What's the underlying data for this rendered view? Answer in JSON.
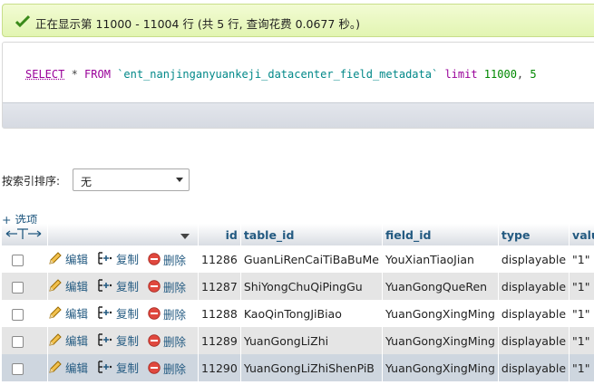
{
  "banner": {
    "message": "正在显示第 11000 - 11004 行 (共 5 行, 查询花费 0.0677 秒。)"
  },
  "sql": {
    "select_kw": "SELECT",
    "star": " * ",
    "from_kw": "FROM",
    "table_name": "`ent_nanjinganyuankeji_datacenter_field_metadata`",
    "limit_kw": "limit",
    "offset": "11000",
    "comma": ", ",
    "count": "5"
  },
  "sort": {
    "label": "按索引排序:",
    "selected": "无"
  },
  "options_link": "+ 选项",
  "table": {
    "headers": [
      "id",
      "table_id",
      "field_id",
      "type",
      "value"
    ],
    "actions": {
      "edit": "编辑",
      "copy": "复制",
      "delete": "删除"
    },
    "rows": [
      {
        "id": "11286",
        "table_id": "GuanLiRenCaiTiBaBuMe",
        "field_id": "YouXianTiaoJian",
        "type": "displayable",
        "value": "\"1\""
      },
      {
        "id": "11287",
        "table_id": "ShiYongChuQiPingGu",
        "field_id": "YuanGongQueRen",
        "type": "displayable",
        "value": "\"1\""
      },
      {
        "id": "11288",
        "table_id": "KaoQinTongJiBiao",
        "field_id": "YuanGongXingMing",
        "type": "displayable",
        "value": "\"1\""
      },
      {
        "id": "11289",
        "table_id": "YuanGongLiZhi",
        "field_id": "YuanGongXingMing",
        "type": "displayable",
        "value": "\"1\""
      },
      {
        "id": "11290",
        "table_id": "YuanGongLiZhiShenPiB",
        "field_id": "YuanGongXingMing",
        "type": "displayable",
        "value": "\"1\""
      }
    ]
  },
  "colors": {
    "link": "#235a81",
    "success_bg": "#e2f5b2",
    "row_alt": "#e5e5e5",
    "row_marked": "#ced6df"
  }
}
